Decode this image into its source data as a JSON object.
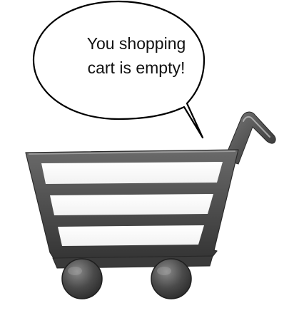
{
  "message": {
    "line1": "You shopping",
    "line2": "cart is empty!"
  },
  "icon": "shopping-cart-icon",
  "colors": {
    "background": "#ffffff",
    "bubble_fill": "#ffffff",
    "bubble_stroke": "#000000",
    "cart_dark": "#3b3b3b",
    "cart_mid": "#5a5a5a",
    "cart_light": "#bdbdbd",
    "wheel": "#4a4a4a"
  }
}
